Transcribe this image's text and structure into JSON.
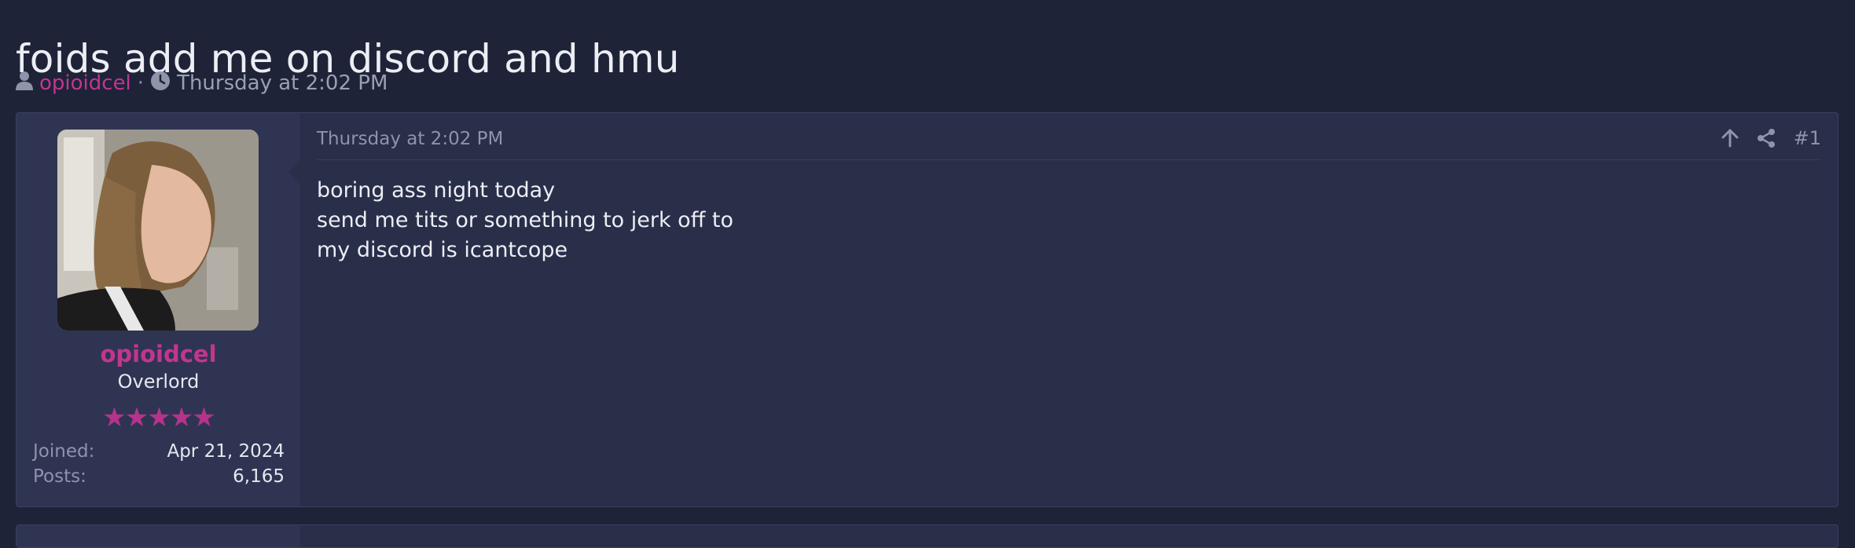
{
  "thread": {
    "title": "foids add me on discord and hmu",
    "author": "opioidcel",
    "separator": "·",
    "date": "Thursday at 2:02 PM"
  },
  "post": {
    "date": "Thursday at 2:02 PM",
    "number": "#1",
    "lines": [
      "boring ass night today",
      "send me tits or something to jerk off to",
      "my discord is icantcope"
    ],
    "user": {
      "name": "opioidcel",
      "title": "Overlord",
      "stars": "★★★★★",
      "joined_label": "Joined:",
      "joined_value": "Apr 21, 2024",
      "posts_label": "Posts:",
      "posts_value": "6,165"
    }
  },
  "icons": {
    "meta_user": "user-icon",
    "meta_clock": "clock-icon",
    "upvote": "arrow-up-icon",
    "share": "share-icon"
  },
  "colors": {
    "background": "#1e2338",
    "post_background": "#292e49",
    "user_panel": "#2f3453",
    "accent": "#c2368f",
    "muted": "#8e94aa"
  }
}
